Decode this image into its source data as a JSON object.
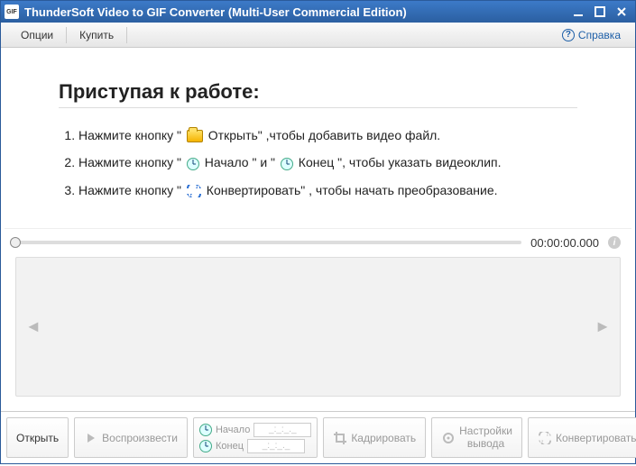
{
  "title": "ThunderSoft Video to GIF Converter (Multi-User Commercial Edition)",
  "menubar": {
    "options": "Опции",
    "buy": "Купить",
    "help": "Справка"
  },
  "intro": {
    "heading": "Приступая к работе:",
    "step1_a": "Нажмите кнопку \" ",
    "step1_b": " Открыть\" ,чтобы добавить видео файл.",
    "step2_a": "Нажмите кнопку \" ",
    "step2_b": " Начало \" и \" ",
    "step2_c": " Конец \", чтобы указать видеоклип.",
    "step3_a": "Нажмите кнопку \" ",
    "step3_b": " Конвертировать\" , чтобы начать преобразование."
  },
  "player": {
    "timecode": "00:00:00.000"
  },
  "toolbar": {
    "open": "Открыть",
    "play": "Воспроизвести",
    "begin": "Начало",
    "end": "Конец",
    "time_placeholder": "_:_:_._",
    "crop": "Кадрировать",
    "output_l1": "Настройки",
    "output_l2": "вывода",
    "convert": "Конвертировать"
  }
}
